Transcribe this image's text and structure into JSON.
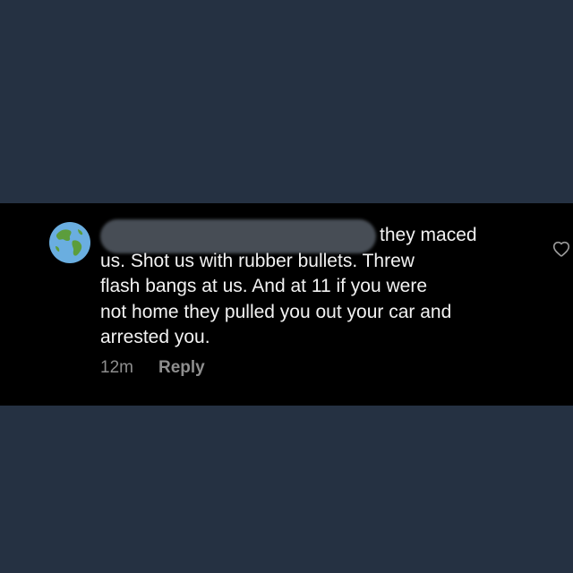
{
  "comment": {
    "username": "",
    "text_lines": [
      "they maced",
      "us. Shot us with rubber bullets. Threw",
      "flash bangs at us. And at 11 if you were",
      "not home they pulled you out your car and",
      "arrested you."
    ],
    "timestamp": "12m",
    "reply_label": "Reply",
    "avatar_icon": "globe-earth-icon",
    "like_icon": "heart-outline-icon"
  },
  "colors": {
    "page_background": "#253142",
    "panel_background": "#000000",
    "text": "#f2f2f2",
    "muted": "#8e8e8e"
  }
}
